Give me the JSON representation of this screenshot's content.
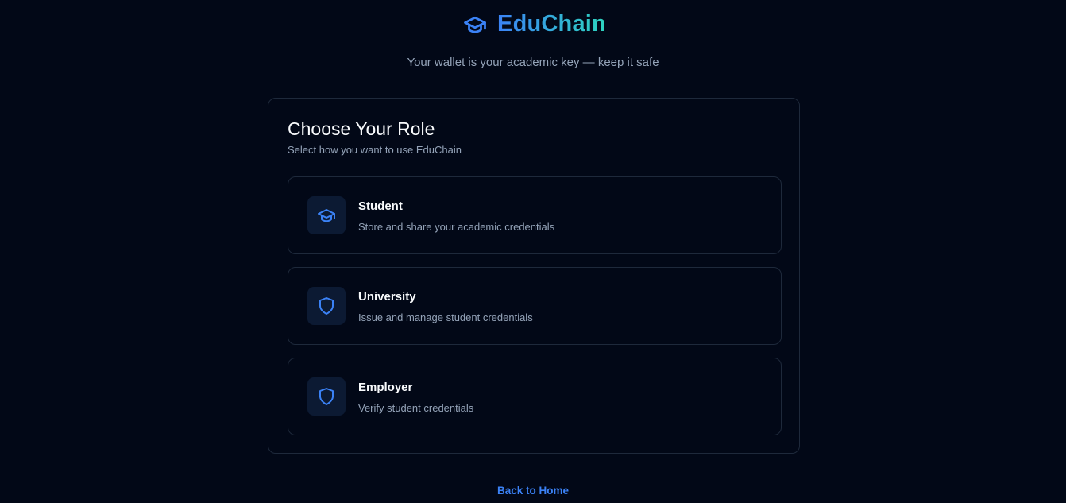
{
  "brand": {
    "name": "EduChain",
    "icon": "graduation-cap-icon",
    "gradient_start": "#3b82f6",
    "gradient_end": "#2dd4bf"
  },
  "tagline": "Your wallet is your academic key — keep it safe",
  "card": {
    "title": "Choose Your Role",
    "subtitle": "Select how you want to use EduChain"
  },
  "roles": [
    {
      "name": "Student",
      "description": "Store and share your academic credentials",
      "icon": "graduation-cap-icon"
    },
    {
      "name": "University",
      "description": "Issue and manage student credentials",
      "icon": "shield-icon"
    },
    {
      "name": "Employer",
      "description": "Verify student credentials",
      "icon": "shield-icon"
    }
  ],
  "back_link": "Back to Home",
  "colors": {
    "background": "#020817",
    "accent": "#3b82f6",
    "border": "#1e293b",
    "text_muted": "#94a3b8"
  }
}
